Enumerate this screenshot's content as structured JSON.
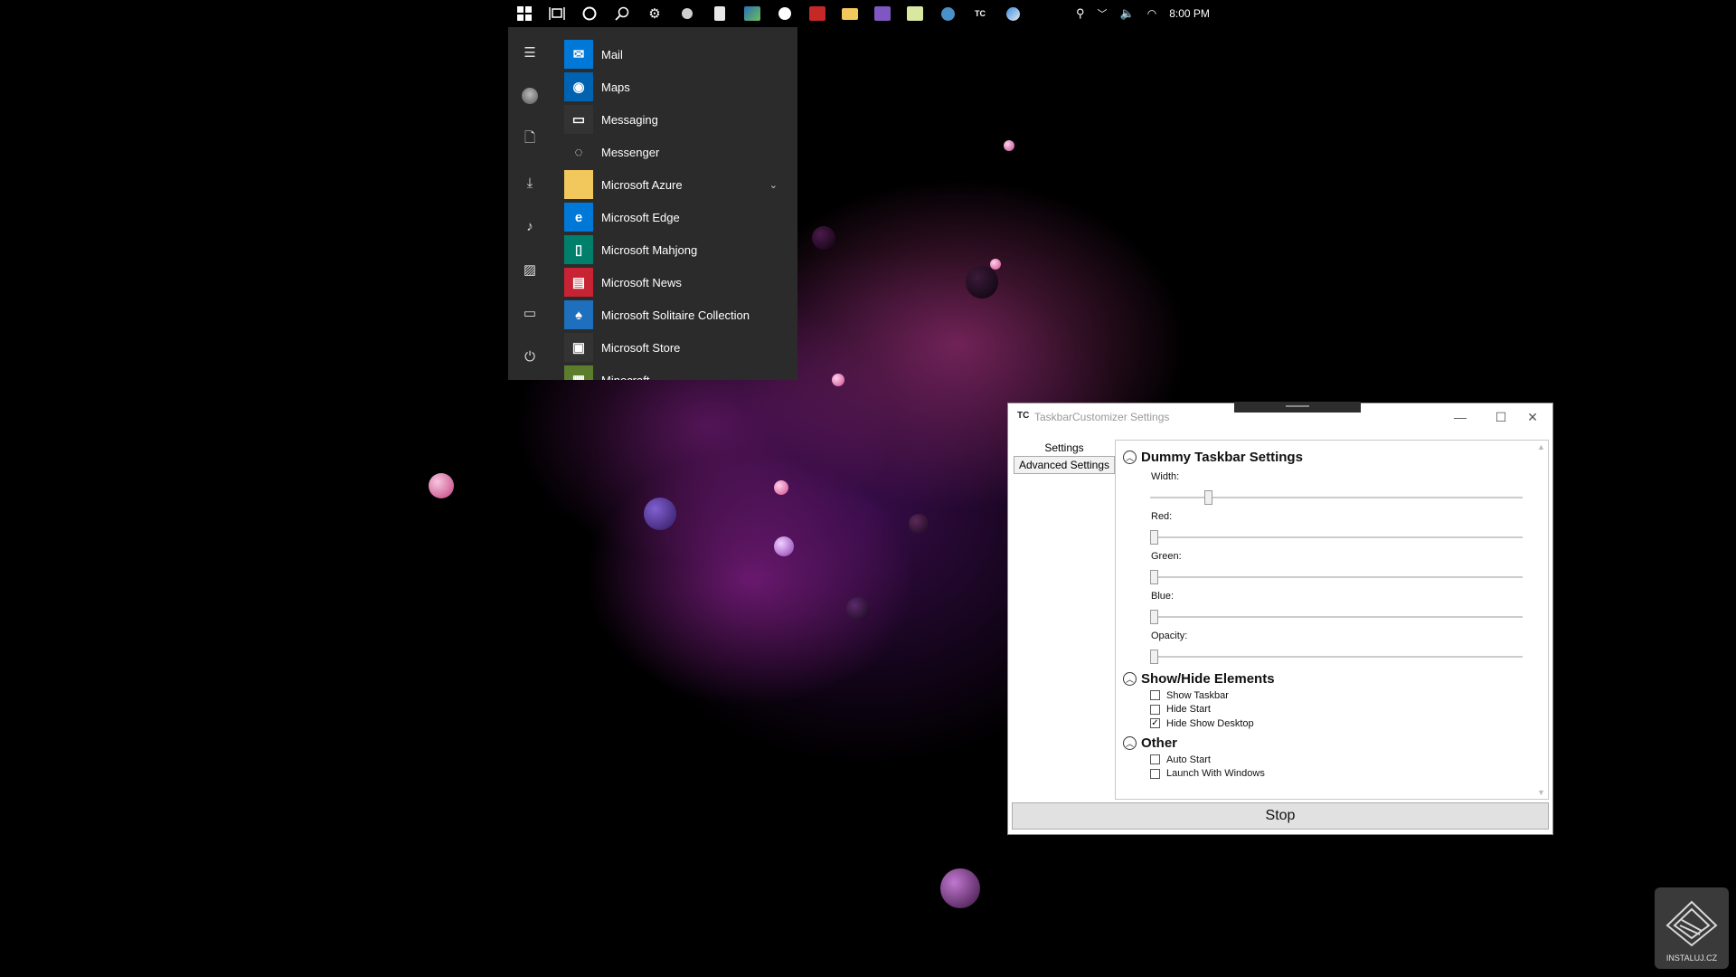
{
  "taskbar": {
    "icons": [
      "windows-start",
      "task-view",
      "cortana",
      "search",
      "settings",
      "app",
      "app",
      "app",
      "app",
      "app",
      "file-explorer",
      "visual-studio",
      "notepad",
      "steam",
      "taskbar-customizer",
      "app"
    ],
    "tc_label": "TC",
    "clock": "8:00 PM"
  },
  "start_menu": {
    "apps": [
      {
        "label": "Mail",
        "color": "#0078d7",
        "glyph": "✉"
      },
      {
        "label": "Maps",
        "color": "#0063b1",
        "glyph": "◉"
      },
      {
        "label": "Messaging",
        "color": "#333333",
        "glyph": "▭"
      },
      {
        "label": "Messenger",
        "color": "#2b2b2b",
        "glyph": "◌"
      },
      {
        "label": "Microsoft Azure",
        "color": "#f2c75c",
        "glyph": ""
      },
      {
        "label": "Microsoft Edge",
        "color": "#0078d7",
        "glyph": "e"
      },
      {
        "label": "Microsoft Mahjong",
        "color": "#00806b",
        "glyph": "▯"
      },
      {
        "label": "Microsoft News",
        "color": "#c82333",
        "glyph": "▤"
      },
      {
        "label": "Microsoft Solitaire Collection",
        "color": "#1e6fbd",
        "glyph": "♠"
      },
      {
        "label": "Microsoft Store",
        "color": "#333333",
        "glyph": "▣"
      },
      {
        "label": "Minecraft",
        "color": "#5b7d2d",
        "glyph": "▦"
      }
    ]
  },
  "window": {
    "title": "TaskbarCustomizer Settings",
    "logo": "TC",
    "tabs": [
      "Settings",
      "Advanced Settings"
    ],
    "sections": {
      "dummy": {
        "title": "Dummy Taskbar Settings",
        "sliders": [
          {
            "label": "Width:",
            "value": 0.15
          },
          {
            "label": "Red:",
            "value": 0
          },
          {
            "label": "Green:",
            "value": 0
          },
          {
            "label": "Blue:",
            "value": 0
          },
          {
            "label": "Opacity:",
            "value": 0
          }
        ]
      },
      "showhide": {
        "title": "Show/Hide Elements",
        "items": [
          {
            "label": "Show Taskbar",
            "checked": false
          },
          {
            "label": "Hide Start",
            "checked": false
          },
          {
            "label": "Hide Show Desktop",
            "checked": true
          }
        ]
      },
      "other": {
        "title": "Other",
        "items": [
          {
            "label": "Auto Start",
            "checked": false
          },
          {
            "label": "Launch With Windows",
            "checked": false
          }
        ]
      }
    },
    "stop_label": "Stop"
  },
  "watermark": {
    "text": "INSTALUJ.CZ"
  }
}
